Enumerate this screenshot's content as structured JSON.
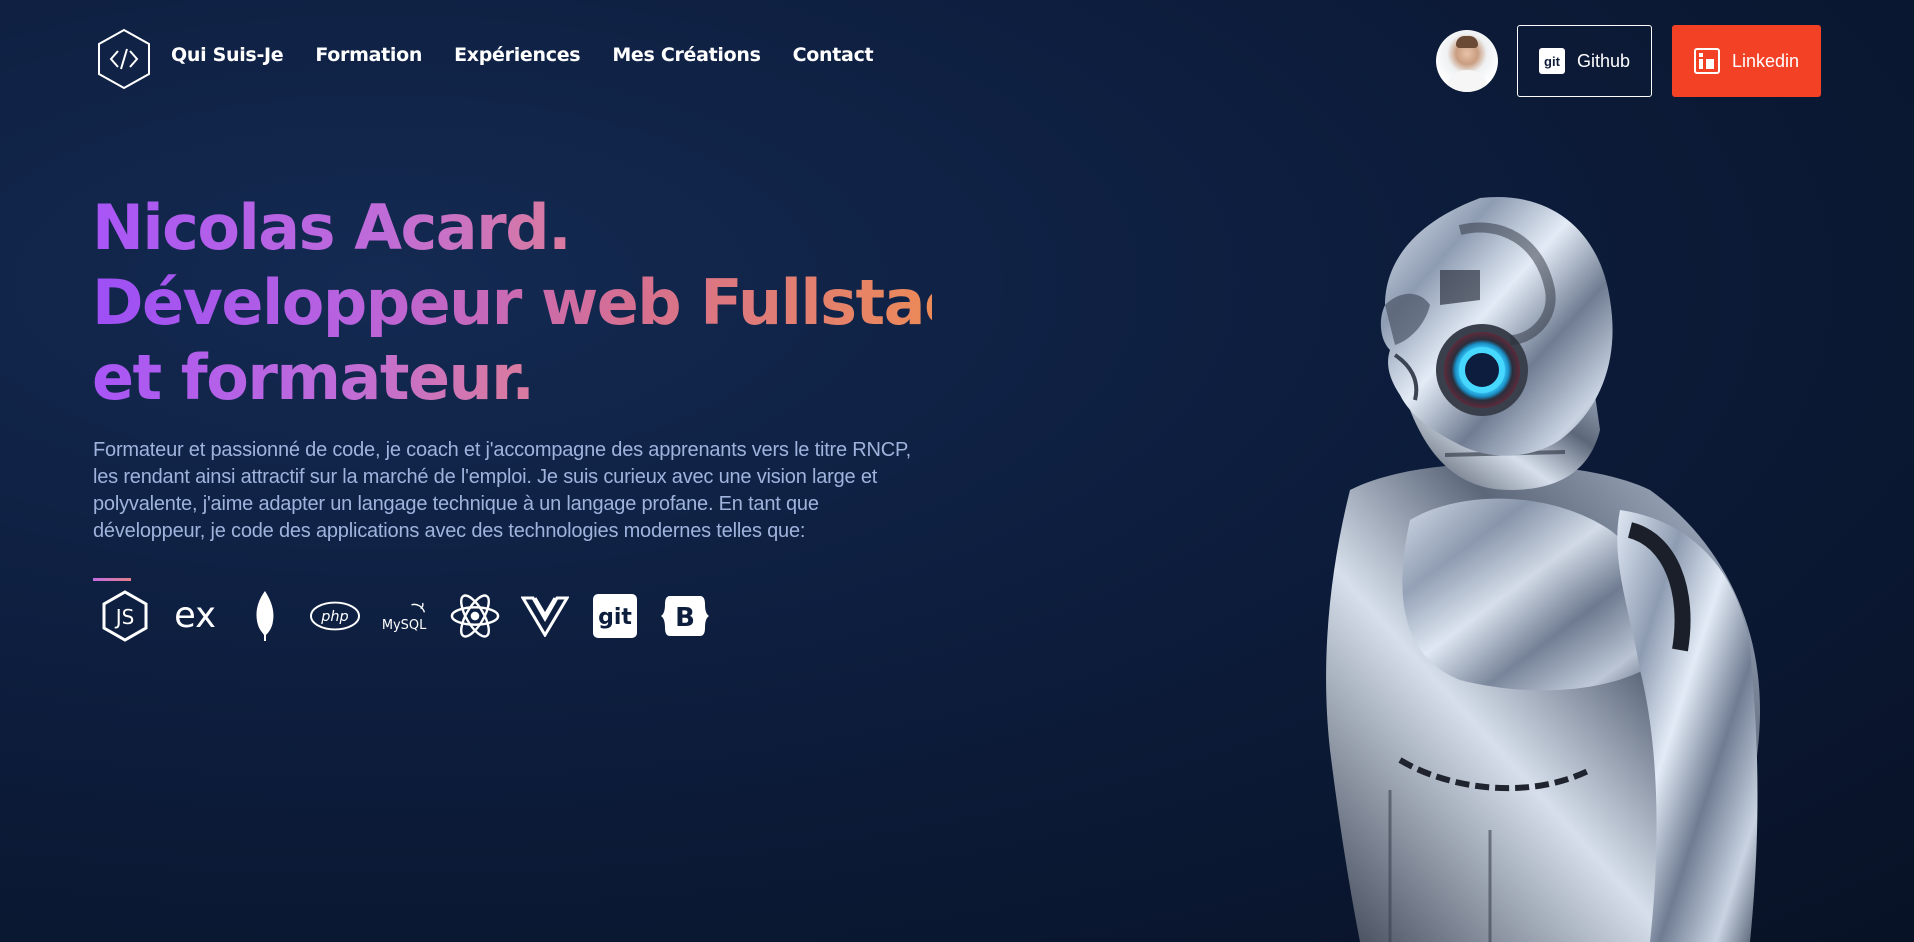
{
  "header": {
    "nav": [
      {
        "label": "Qui Suis-Je"
      },
      {
        "label": "Formation"
      },
      {
        "label": "Expériences"
      },
      {
        "label": "Mes Créations"
      },
      {
        "label": "Contact"
      }
    ],
    "github_label": "Github",
    "linkedin_label": "Linkedin",
    "git_badge": "git"
  },
  "hero": {
    "title_line1": "Nicolas Acard.",
    "title_line2": "Développeur web Fullstack",
    "title_line3": "et formateur.",
    "description": "Formateur et passionné de code, je coach et j'accompagne des apprenants vers le titre RNCP, les rendant ainsi attractif sur la marché de l'emploi. Je suis curieux avec une vision large et polyvalente, j'aime adapter un langage technique à un langage profane. En tant que développeur, je code des applications avec des technologies modernes telles que:"
  },
  "tech_icons": {
    "js": "JS",
    "express": "ex",
    "php": "php",
    "mysql": "MySQL",
    "git": "git",
    "bootstrap": "B"
  },
  "colors": {
    "background": "#0d1d3d",
    "linkedin": "#f34126",
    "text_muted": "#9fb3dd",
    "gradient_purple": "#a855f7",
    "gradient_orange": "#ec8a58"
  }
}
